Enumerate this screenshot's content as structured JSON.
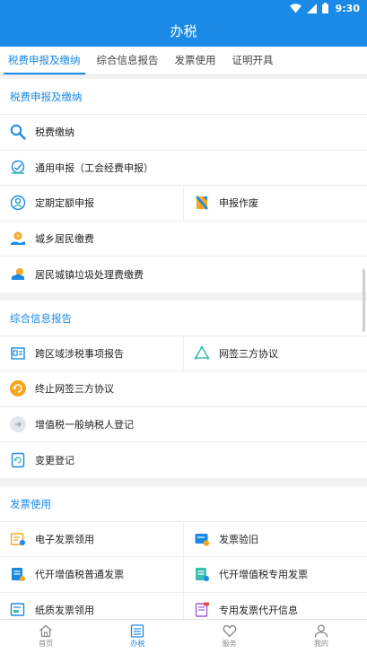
{
  "status_bar": {
    "time": "9:30"
  },
  "app_bar": {
    "title": "办税"
  },
  "tabs": [
    {
      "label": "税费申报及缴纳",
      "active": true
    },
    {
      "label": "综合信息报告",
      "active": false
    },
    {
      "label": "发票使用",
      "active": false
    },
    {
      "label": "证明开具",
      "active": false
    }
  ],
  "sections": {
    "tax_filing": {
      "title": "税费申报及缴纳",
      "items": {
        "tax_payment": "税费缴纳",
        "general_filing": "通用申报（工会经费申报）",
        "fixed_quota_filing": "定期定额申报",
        "filing_void": "申报作废",
        "urban_rural_fee": "城乡居民缴费",
        "garbage_fee": "居民城镇垃圾处理费缴费"
      }
    },
    "info_report": {
      "title": "综合信息报告",
      "items": {
        "cross_region_report": "跨区域涉税事项报告",
        "online_agreement": "网签三方协议",
        "terminate_agreement": "终止网签三方协议",
        "vat_registration": "增值税一般纳税人登记",
        "change_registration": "变更登记"
      }
    },
    "invoice": {
      "title": "发票使用",
      "items": {
        "e_invoice_claim": "电子发票领用",
        "invoice_verify": "发票验旧",
        "vat_normal_invoice": "代开增值税普通发票",
        "vat_special_invoice": "代开增值税专用发票",
        "paper_invoice_claim": "纸质发票领用",
        "special_invoice_info": "专用发票代开信息"
      }
    }
  },
  "bottom_nav": [
    {
      "label": "首页",
      "active": false
    },
    {
      "label": "办税",
      "active": true
    },
    {
      "label": "服务",
      "active": false
    },
    {
      "label": "我的",
      "active": false
    }
  ],
  "colors": {
    "primary": "#1a8ae6",
    "orange": "#f5a623",
    "teal": "#3dbfb0"
  }
}
